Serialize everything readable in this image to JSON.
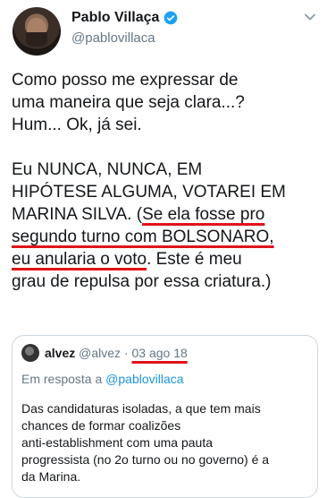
{
  "author": {
    "name": "Pablo Villaça",
    "handle": "@pablovillaca"
  },
  "tweet": {
    "line1": "Como posso me expressar de",
    "line2": "uma maneira que seja clara...?",
    "line3": "Hum... Ok, já sei.",
    "line4": "Eu NUNCA, NUNCA, EM",
    "line5": "HIPÓTESE ALGUMA, VOTAREI EM",
    "line6_a": "MARINA SILVA. (",
    "line6_b": "Se ela fosse pro",
    "line7": "segundo turno com BOLSONARO,",
    "line8_a": "eu anularia o voto",
    "line8_b": ". Este é meu",
    "line9": "grau de repulsa por essa criatura.)"
  },
  "quote": {
    "name": "alvez",
    "handle": "@alvez",
    "separator": "·",
    "date": "03 ago 18",
    "reply_prefix": "Em resposta a ",
    "reply_mention": "@pablovillaca",
    "text_line1": "Das candidaturas isoladas, a que tem mais",
    "text_line2": "chances de formar coalizões",
    "text_line3": "anti-establishment com uma pauta",
    "text_line4": "progressista (no 2o turno ou no governo) é a",
    "text_line5": "da Marina."
  },
  "colors": {
    "link": "#1b95e0",
    "underline_annotation": "#e0141b",
    "muted": "#657786"
  },
  "icons": [
    "verified-badge-icon",
    "chevron-down-icon"
  ]
}
